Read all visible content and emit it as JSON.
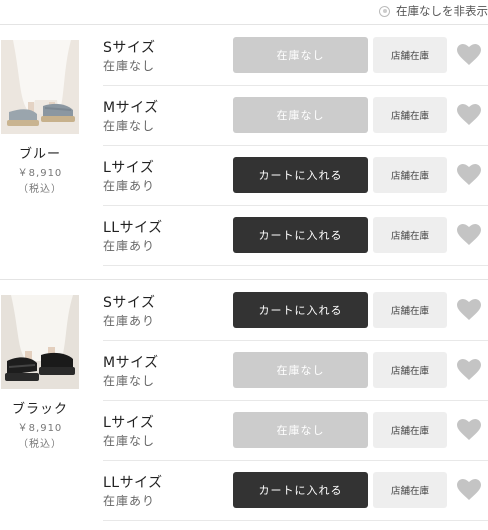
{
  "filter": {
    "label": "在庫なしを非表示"
  },
  "products": [
    {
      "name": "ブルー",
      "price": "￥8,910",
      "tax": "（税込）",
      "thumbnail": "blue-sandal-photo",
      "rows": [
        {
          "size": "Sサイズ",
          "stock": "在庫なし",
          "button": "在庫なし",
          "available": false,
          "store": "店舗在庫"
        },
        {
          "size": "Mサイズ",
          "stock": "在庫なし",
          "button": "在庫なし",
          "available": false,
          "store": "店舗在庫"
        },
        {
          "size": "Lサイズ",
          "stock": "在庫あり",
          "button": "カートに入れる",
          "available": true,
          "store": "店舗在庫"
        },
        {
          "size": "LLサイズ",
          "stock": "在庫あり",
          "button": "カートに入れる",
          "available": true,
          "store": "店舗在庫"
        }
      ]
    },
    {
      "name": "ブラック",
      "price": "￥8,910",
      "tax": "（税込）",
      "thumbnail": "black-sandal-photo",
      "rows": [
        {
          "size": "Sサイズ",
          "stock": "在庫あり",
          "button": "カートに入れる",
          "available": true,
          "store": "店舗在庫"
        },
        {
          "size": "Mサイズ",
          "stock": "在庫なし",
          "button": "在庫なし",
          "available": false,
          "store": "店舗在庫"
        },
        {
          "size": "Lサイズ",
          "stock": "在庫なし",
          "button": "在庫なし",
          "available": false,
          "store": "店舗在庫"
        },
        {
          "size": "LLサイズ",
          "stock": "在庫あり",
          "button": "カートに入れる",
          "available": true,
          "store": "店舗在庫"
        }
      ]
    }
  ],
  "colors": {
    "cart_available": "#333333",
    "cart_soldout": "#cccccc",
    "store_bg": "#eeeeee",
    "heart": "#c4c4c4"
  },
  "icons": {
    "favorite": "heart-icon",
    "filter": "radio-icon"
  }
}
